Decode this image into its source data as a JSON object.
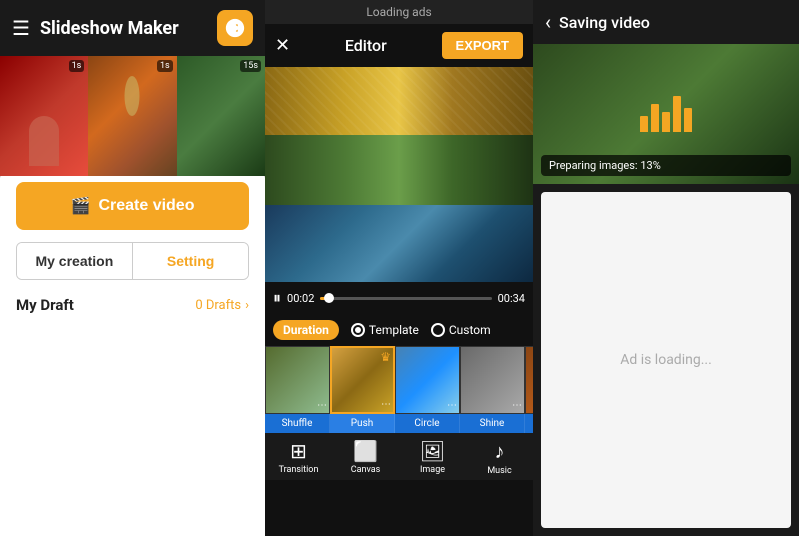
{
  "app": {
    "title": "Slideshow Maker"
  },
  "ads_bar": {
    "text": "Loading ads"
  },
  "editor": {
    "title": "Editor",
    "export_btn": "EXPORT",
    "time_start": "00:02",
    "time_end": "00:34",
    "duration_label": "Duration",
    "template_label": "Template",
    "custom_label": "Custom"
  },
  "transitions": {
    "items": [
      "Shuffle",
      "Push",
      "Circle",
      "Shine"
    ]
  },
  "toolbar": {
    "items": [
      {
        "label": "Transition",
        "icon": "⊞"
      },
      {
        "label": "Canvas",
        "icon": "⬜"
      },
      {
        "label": "Image",
        "icon": "🖼"
      },
      {
        "label": "Music",
        "icon": "♪"
      }
    ]
  },
  "left": {
    "create_btn": "Create video",
    "my_creation_label": "My creation",
    "setting_label": "Setting",
    "my_draft_label": "My Draft",
    "draft_count": "0 Drafts"
  },
  "saving": {
    "title": "Saving video",
    "progress_text": "Preparing images: 13%",
    "ad_loading": "Ad is loading..."
  }
}
